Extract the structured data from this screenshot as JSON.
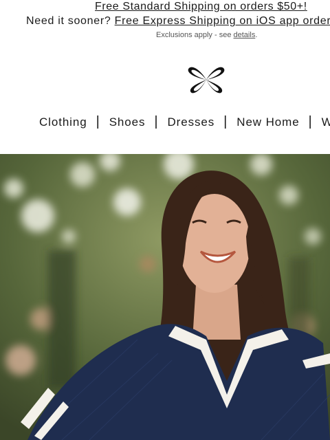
{
  "promo": {
    "standard_shipping": "Free Standard Shipping on orders $50+!",
    "need_it_sooner": "Need it sooner?",
    "express_shipping": "Free Express Shipping on iOS app orders",
    "exclusions_prefix": "Exclusions apply - see",
    "exclusions_link": "details",
    "exclusions_suffix": "."
  },
  "logo": {
    "icon": "butterfly-logo-icon"
  },
  "nav": {
    "items": [
      "Clothing",
      "Shoes",
      "Dresses",
      "New Home",
      "We"
    ],
    "separator": "|"
  },
  "hero": {
    "colors": {
      "foliage": "#5c6e3a",
      "sweater": "#1f2d4f",
      "collar": "#f4f1ea",
      "hair": "#3a2418"
    }
  }
}
